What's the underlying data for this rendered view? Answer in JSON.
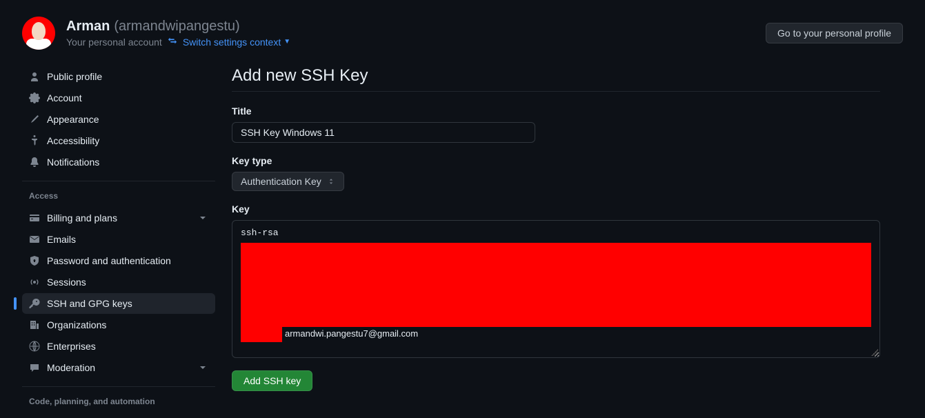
{
  "header": {
    "display_name": "Arman",
    "username": "(armandwipangestu)",
    "sub_text": "Your personal account",
    "switch_link": "Switch settings context",
    "profile_button": "Go to your personal profile"
  },
  "sidebar": {
    "top": [
      {
        "label": "Public profile"
      },
      {
        "label": "Account"
      },
      {
        "label": "Appearance"
      },
      {
        "label": "Accessibility"
      },
      {
        "label": "Notifications"
      }
    ],
    "section_access": "Access",
    "access": [
      {
        "label": "Billing and plans",
        "expandable": true
      },
      {
        "label": "Emails"
      },
      {
        "label": "Password and authentication"
      },
      {
        "label": "Sessions"
      },
      {
        "label": "SSH and GPG keys",
        "active": true
      },
      {
        "label": "Organizations"
      },
      {
        "label": "Enterprises"
      },
      {
        "label": "Moderation",
        "expandable": true
      }
    ],
    "section_code": "Code, planning, and automation"
  },
  "main": {
    "title": "Add new SSH Key",
    "title_label": "Title",
    "title_value": "SSH Key Windows 11",
    "keytype_label": "Key type",
    "keytype_value": "Authentication Key",
    "key_label": "Key",
    "key_prefix": "ssh-rsa",
    "key_suffix": "armandwi.pangestu7@gmail.com",
    "submit_label": "Add SSH key"
  }
}
